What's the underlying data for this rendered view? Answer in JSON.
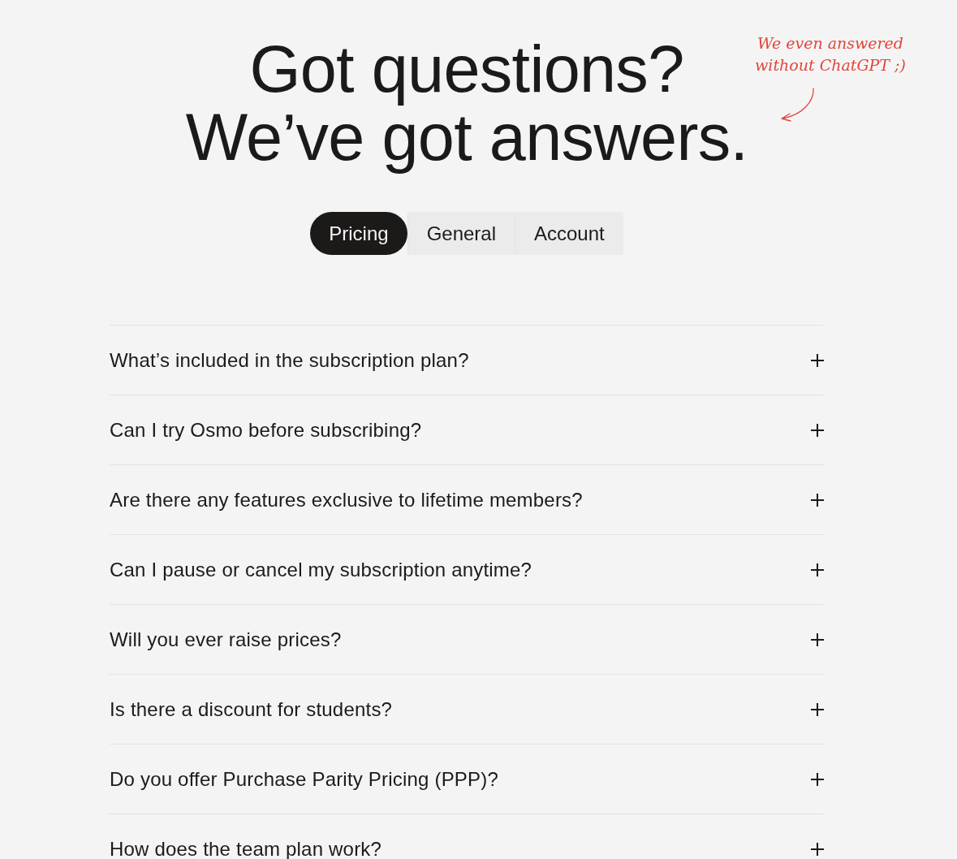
{
  "heading": {
    "lines": [
      "Got questions?",
      "We’ve got answers."
    ]
  },
  "note": {
    "text": "We even answered\nwithout ChatGPT ;)"
  },
  "tabs": [
    {
      "label": "Pricing",
      "selected": true
    },
    {
      "label": "General",
      "selected": false
    },
    {
      "label": "Account",
      "selected": false
    }
  ],
  "faq": {
    "items": [
      {
        "question": "What’s included in the subscription plan?",
        "expanded": false
      },
      {
        "question": "Can I try Osmo before subscribing?",
        "expanded": false
      },
      {
        "question": "Are there any features exclusive to lifetime members?",
        "expanded": false
      },
      {
        "question": "Can I pause or cancel my subscription anytime?",
        "expanded": false
      },
      {
        "question": "Will you ever raise prices?",
        "expanded": false
      },
      {
        "question": "Is there a discount for students?",
        "expanded": false
      },
      {
        "question": "Do you offer Purchase Parity Pricing (PPP)?",
        "expanded": false
      },
      {
        "question": "How does the team plan work?",
        "expanded": false
      }
    ]
  }
}
